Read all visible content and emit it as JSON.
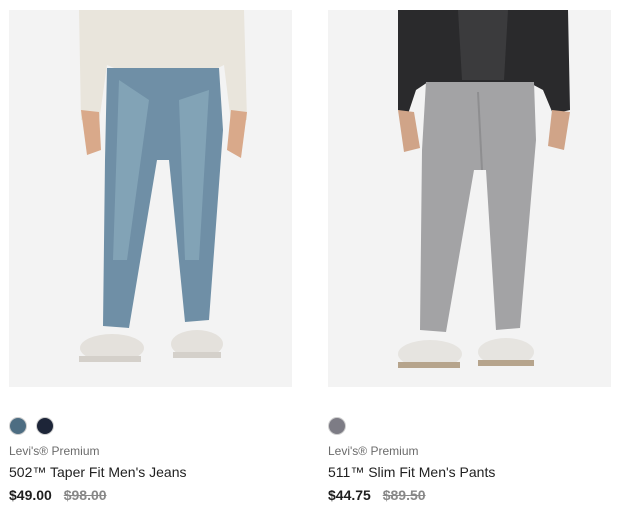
{
  "products": [
    {
      "brand": "Levi's® Premium",
      "name": "502™ Taper Fit Men's Jeans",
      "price": "$49.00",
      "original_price": "$98.00",
      "swatches": [
        "#4d6d82",
        "#1d2538"
      ],
      "image": "product-photo-blue-jeans"
    },
    {
      "brand": "Levi's® Premium",
      "name": "511™ Slim Fit Men's Pants",
      "price": "$44.75",
      "original_price": "$89.50",
      "swatches": [
        "#7d7c85"
      ],
      "image": "product-photo-grey-pants"
    }
  ]
}
